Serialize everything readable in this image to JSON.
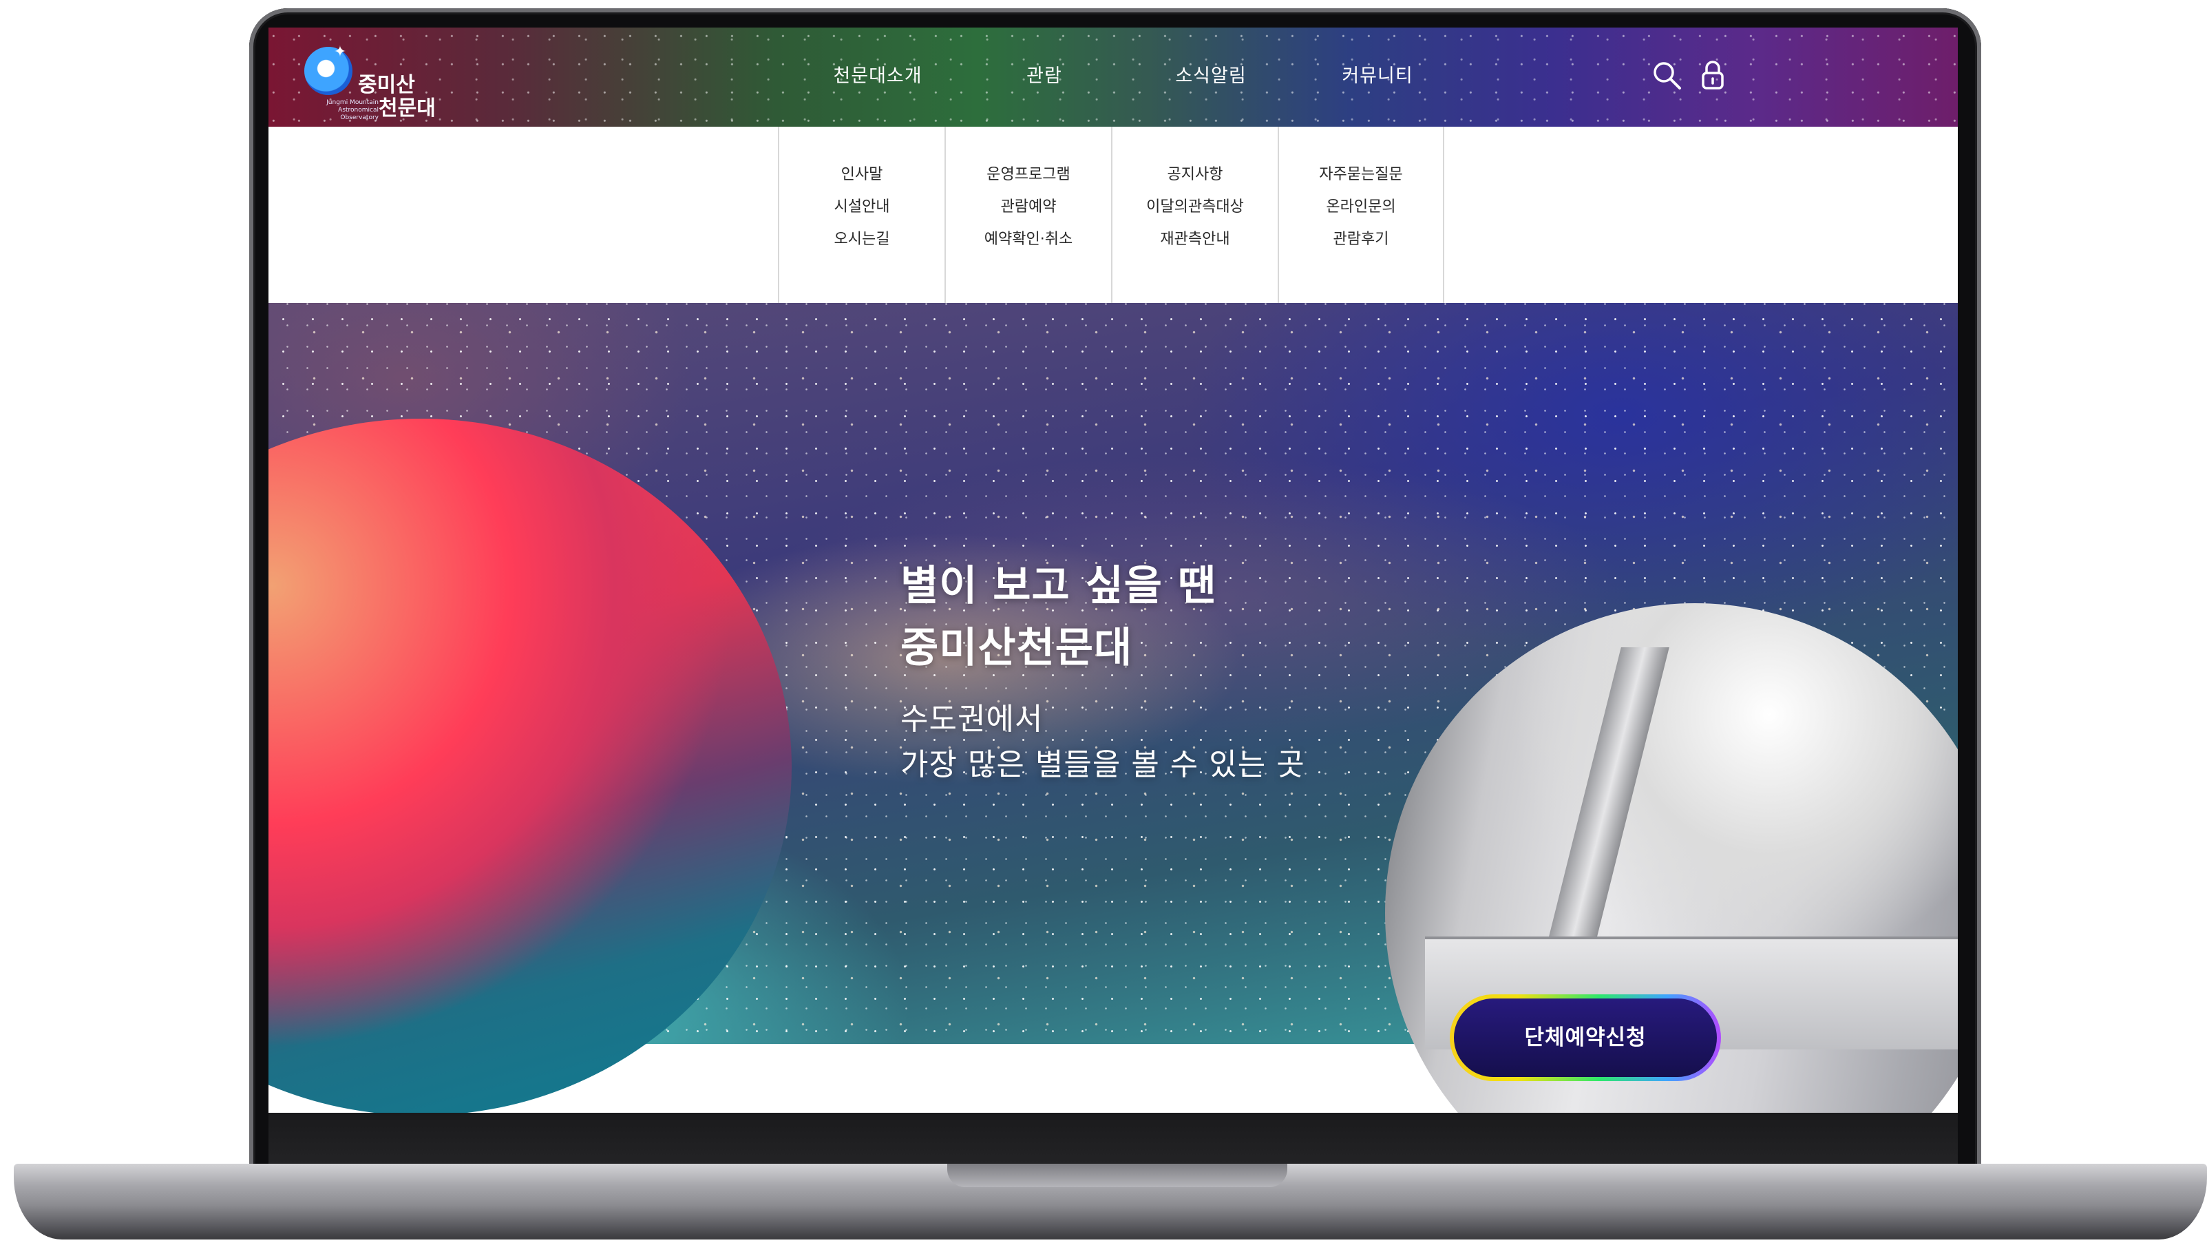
{
  "header": {
    "logo": {
      "line1": "중미산",
      "line2": "천문대",
      "subtitle": "Jungmi Mountain Astronomical Observatory"
    },
    "nav": [
      {
        "label": "천문대소개"
      },
      {
        "label": "관람"
      },
      {
        "label": "소식알림"
      },
      {
        "label": "커뮤니티"
      }
    ],
    "icons": [
      "search-icon",
      "lock-icon"
    ]
  },
  "dropdown": {
    "columns": [
      {
        "items": [
          "인사말",
          "시설안내",
          "오시는길"
        ]
      },
      {
        "items": [
          "운영프로그램",
          "관람예약",
          "예약확인·취소"
        ]
      },
      {
        "items": [
          "공지사항",
          "이달의관측대상",
          "재관측안내"
        ]
      },
      {
        "items": [
          "자주묻는질문",
          "온라인문의",
          "관람후기"
        ]
      }
    ]
  },
  "hero": {
    "title_line1": "별이 보고 싶을 땐",
    "title_line2": "중미산천문대",
    "sub_line1": "수도권에서",
    "sub_line2": "가장 많은 별들을 볼 수 있는 곳",
    "cta_label": "단체예약신청"
  },
  "colors": {
    "cta_bg": "#1b136a",
    "planet_red": "#ff3d58",
    "planet_teal": "#0f7d92"
  }
}
